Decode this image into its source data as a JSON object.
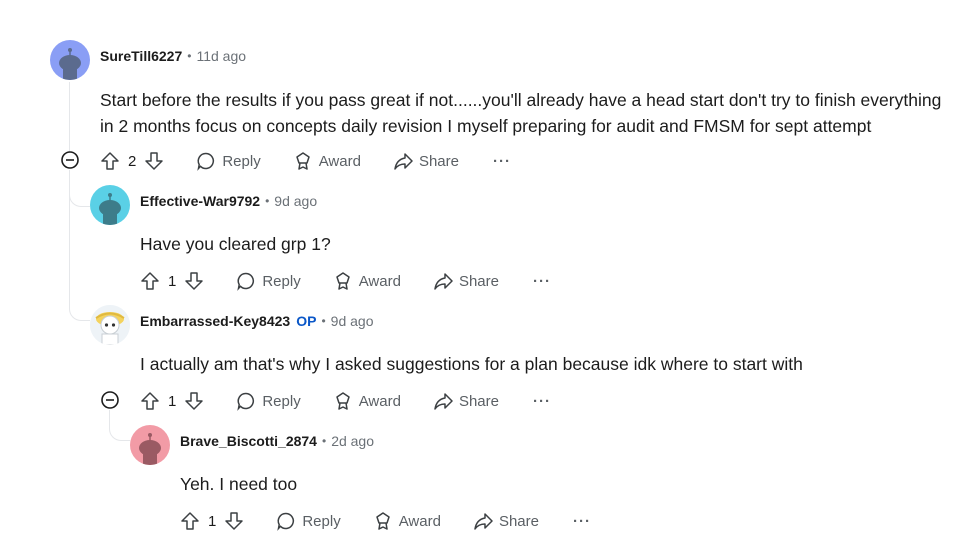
{
  "comments": [
    {
      "username": "SureTill6227",
      "separator": "•",
      "time": "11d ago",
      "body": "Start before the results if you pass great if not......you'll already have a head start don't try to finish everything in 2 months focus on concepts daily revision I myself preparing for audit and FMSM for sept attempt",
      "votes": "2",
      "reply": "Reply",
      "award": "Award",
      "share": "Share",
      "more": "···",
      "avatar_color": "#8a9ef5"
    },
    {
      "username": "Effective-War9792",
      "separator": "•",
      "time": "9d ago",
      "body": "Have you cleared grp 1?",
      "votes": "1",
      "reply": "Reply",
      "award": "Award",
      "share": "Share",
      "more": "···",
      "avatar_color": "#5ad0e6"
    },
    {
      "username": "Embarrassed-Key8423",
      "op_badge": "OP",
      "separator": "•",
      "time": "9d ago",
      "body": "I actually am that's why I asked suggestions for a plan because idk where to start with",
      "votes": "1",
      "reply": "Reply",
      "award": "Award",
      "share": "Share",
      "more": "···",
      "avatar_color": "#f4d35e"
    },
    {
      "username": "Brave_Biscotti_2874",
      "separator": "•",
      "time": "2d ago",
      "body": "Yeh. I need too",
      "votes": "1",
      "reply": "Reply",
      "award": "Award",
      "share": "Share",
      "more": "···",
      "avatar_color": "#f29ba6"
    }
  ]
}
